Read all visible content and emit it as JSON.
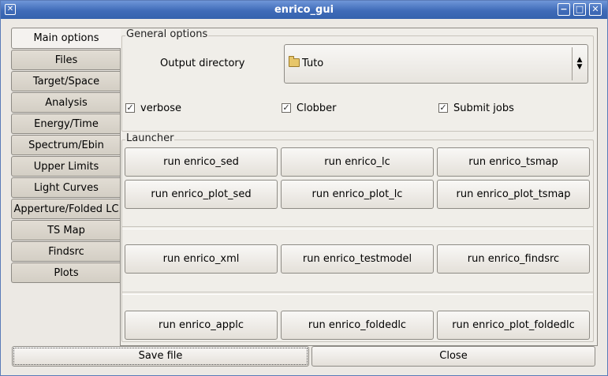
{
  "window": {
    "title": "enrico_gui"
  },
  "tabs": [
    {
      "label": "Main options"
    },
    {
      "label": "Files"
    },
    {
      "label": "Target/Space"
    },
    {
      "label": "Analysis"
    },
    {
      "label": "Energy/Time"
    },
    {
      "label": "Spectrum/Ebin"
    },
    {
      "label": "Upper Limits"
    },
    {
      "label": "Light Curves"
    },
    {
      "label": "Apperture/Folded LC"
    },
    {
      "label": "TS Map"
    },
    {
      "label": "Findsrc"
    },
    {
      "label": "Plots"
    }
  ],
  "general_options": {
    "title": "General options",
    "output_directory_label": "Output directory",
    "output_directory_value": "Tuto",
    "verbose_label": "verbose",
    "verbose_checked": true,
    "clobber_label": "Clobber",
    "clobber_checked": true,
    "submit_jobs_label": "Submit jobs",
    "submit_jobs_checked": true
  },
  "launcher": {
    "title": "Launcher",
    "buttons": [
      "run enrico_sed",
      "run enrico_lc",
      "run enrico_tsmap",
      "run enrico_plot_sed",
      "run enrico_plot_lc",
      "run enrico_plot_tsmap",
      "run enrico_xml",
      "run enrico_testmodel",
      "run enrico_findsrc",
      "run enrico_applc",
      "run enrico_foldedlc",
      "run enrico_plot_foldedlc"
    ]
  },
  "footer": {
    "save_label": "Save file",
    "close_label": "Close"
  }
}
